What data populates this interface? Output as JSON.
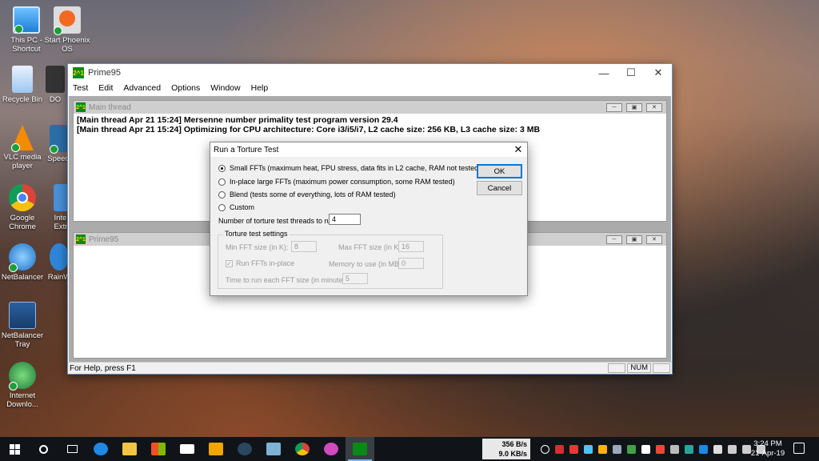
{
  "desktop": {
    "icons": [
      {
        "label": "This PC - Shortcut",
        "icon": "computer-icon"
      },
      {
        "label": "Start Phoenix OS",
        "icon": "phoenix-os-icon"
      },
      {
        "label": "Recycle Bin",
        "icon": "recycle-bin-icon"
      },
      {
        "label": "DO",
        "icon": "game-icon"
      },
      {
        "label": "VLC media player",
        "icon": "vlc-icon"
      },
      {
        "label": "Speed",
        "icon": "speed-icon"
      },
      {
        "label": "Google Chrome",
        "icon": "chrome-icon"
      },
      {
        "label": "Inter Extn",
        "icon": "internet-icon"
      },
      {
        "label": "NetBalancer",
        "icon": "netbalancer-icon"
      },
      {
        "label": "RainW",
        "icon": "rainmeter-icon"
      },
      {
        "label": "NetBalancer Tray",
        "icon": "netbalancer-tray-icon"
      },
      {
        "label": "Internet Downlo...",
        "icon": "idm-icon"
      }
    ]
  },
  "main_window": {
    "title": "Prime95",
    "logo": "2^1",
    "menu": [
      "Test",
      "Edit",
      "Advanced",
      "Options",
      "Window",
      "Help"
    ],
    "thread_window": {
      "title": "Main thread",
      "lines": [
        "[Main thread Apr 21 15:24] Mersenne number primality test program version 29.4",
        "[Main thread Apr 21 15:24] Optimizing for CPU architecture: Core i3/i5/i7, L2 cache size: 256 KB, L3 cache size: 3 MB"
      ]
    },
    "second_window": {
      "title": "Prime95"
    },
    "status": {
      "help": "For Help, press F1",
      "num": "NUM"
    }
  },
  "dialog": {
    "title": "Run a Torture Test",
    "options": [
      {
        "label": "Small FFTs (maximum heat, FPU stress, data fits in L2 cache, RAM not tested much)",
        "selected": true
      },
      {
        "label": "In-place large FFTs (maximum power consumption, some RAM tested)",
        "selected": false
      },
      {
        "label": "Blend (tests some of everything, lots of RAM tested)",
        "selected": false
      },
      {
        "label": "Custom",
        "selected": false
      }
    ],
    "threads_label": "Number of torture test threads to run:",
    "threads_value": "4",
    "ok": "OK",
    "cancel": "Cancel",
    "settings": {
      "title": "Torture test settings",
      "min_fft_label": "Min FFT size (in K):",
      "min_fft_value": "8",
      "max_fft_label": "Max FFT size (in K):",
      "max_fft_value": "16",
      "run_inplace_label": "Run FFTs in-place",
      "run_inplace_checked": true,
      "memory_label": "Memory to use (in MB):",
      "memory_value": "0",
      "time_label": "Time to run each FFT size (in minutes):",
      "time_value": "5"
    }
  },
  "taskbar": {
    "net_up": "356 B/s",
    "net_down": "9.0 KB/s",
    "time": "3:24 PM",
    "date": "21-Apr-19"
  }
}
